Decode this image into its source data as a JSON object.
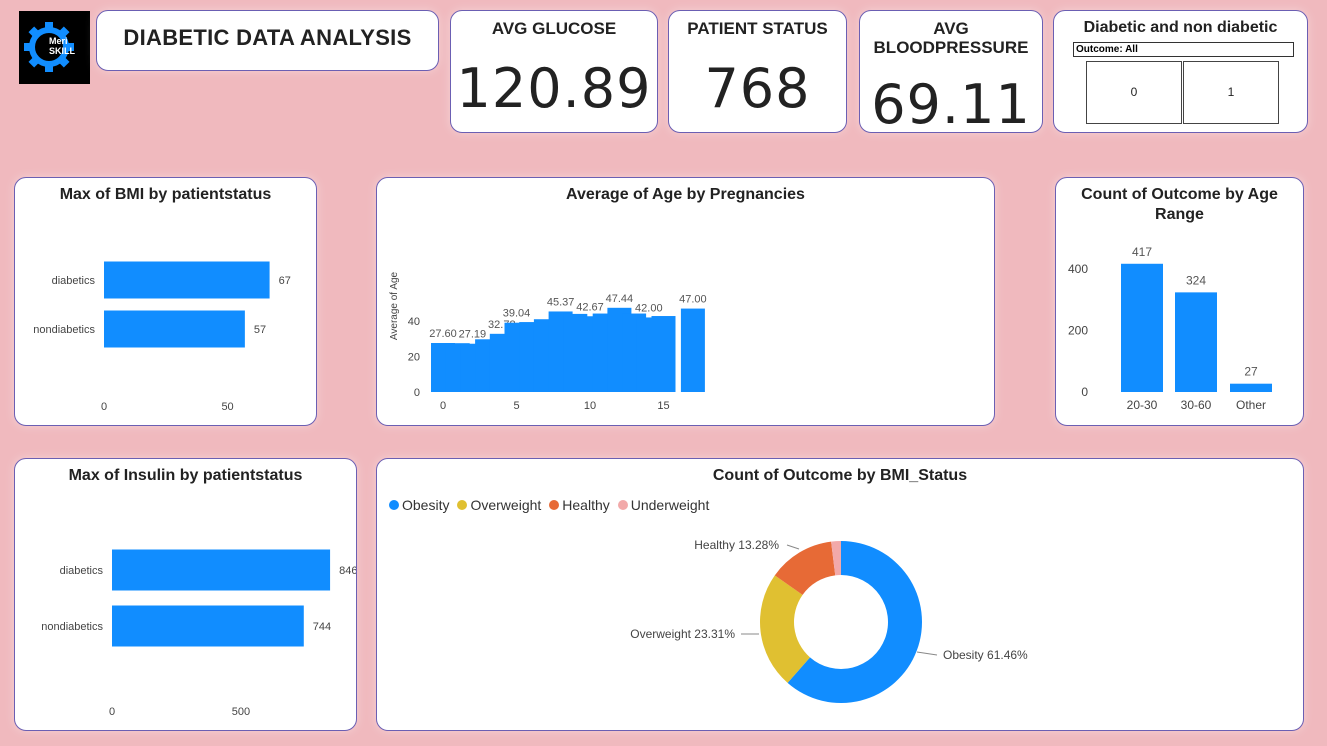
{
  "logo": {
    "line1": "Meri",
    "line2": "SKILL"
  },
  "title": "DIABETIC DATA ANALYSIS",
  "kpis": {
    "glucose": {
      "label": "AVG GLUCOSE",
      "value": "120.89"
    },
    "patients": {
      "label": "PATIENT STATUS",
      "value": "768"
    },
    "bp": {
      "label1": "AVG",
      "label2": "BLOODPRESSURE",
      "value": "69.11"
    }
  },
  "slicer": {
    "title": "Diabetic and non diabetic",
    "header": "Outcome: All",
    "options": [
      "0",
      "1"
    ]
  },
  "colors": {
    "bar": "#118dff",
    "obesity": "#118dff",
    "overweight": "#e0c031",
    "healthy": "#e76a36",
    "underweight": "#f2a9a9"
  },
  "chart_data": [
    {
      "id": "bmi",
      "type": "bar",
      "orientation": "horizontal",
      "title": "Max of BMI by patientstatus",
      "categories": [
        "diabetics",
        "nondiabetics"
      ],
      "values": [
        67,
        57
      ],
      "value_labels": [
        "67",
        "57"
      ],
      "xlim": [
        0,
        70
      ],
      "xticks": [
        "0",
        "50"
      ]
    },
    {
      "id": "age",
      "type": "bar",
      "title": "Average of Age by Pregnancies",
      "ylabel": "Average of Age",
      "x": [
        0,
        1,
        2,
        3,
        4,
        5,
        6,
        7,
        8,
        9,
        10,
        11,
        12,
        13,
        14,
        15,
        17
      ],
      "values": [
        27.6,
        27.5,
        27.19,
        29.7,
        32.78,
        39.04,
        39.4,
        41.0,
        45.37,
        44.0,
        42.67,
        44.2,
        47.44,
        44.2,
        42.0,
        42.8,
        47.0
      ],
      "value_labels": [
        "27.60",
        "",
        "27.19",
        "",
        "32.78",
        "39.04",
        "",
        "",
        "45.37",
        "",
        "42.67",
        "",
        "47.44",
        "",
        "42.00",
        "",
        "47.00"
      ],
      "ylim": [
        0,
        55
      ],
      "yticks": [
        "0",
        "20",
        "40"
      ],
      "xticks": [
        "0",
        "5",
        "10",
        "15"
      ]
    },
    {
      "id": "agerange",
      "type": "bar",
      "title": "Count of Outcome by Age Range",
      "categories": [
        "20-30",
        "30-60",
        "Other"
      ],
      "values": [
        417,
        324,
        27
      ],
      "value_labels": [
        "417",
        "324",
        "27"
      ],
      "ylim": [
        0,
        480
      ],
      "yticks": [
        "0",
        "200",
        "400"
      ]
    },
    {
      "id": "insulin",
      "type": "bar",
      "orientation": "horizontal",
      "title": "Max of Insulin by patientstatus",
      "categories": [
        "diabetics",
        "nondiabetics"
      ],
      "values": [
        846,
        744
      ],
      "value_labels": [
        "846",
        "744"
      ],
      "xlim": [
        0,
        900
      ],
      "xticks": [
        "0",
        "500"
      ]
    },
    {
      "id": "bmistatus",
      "type": "pie",
      "title": "Count of Outcome by BMI_Status",
      "legend": "top-left",
      "categories": [
        "Obesity",
        "Overweight",
        "Healthy",
        "Underweight"
      ],
      "values": [
        61.46,
        23.31,
        13.28,
        1.95
      ],
      "slice_labels": [
        "Obesity 61.46%",
        "Overweight 23.31%",
        "Healthy 13.28%",
        ""
      ]
    }
  ]
}
